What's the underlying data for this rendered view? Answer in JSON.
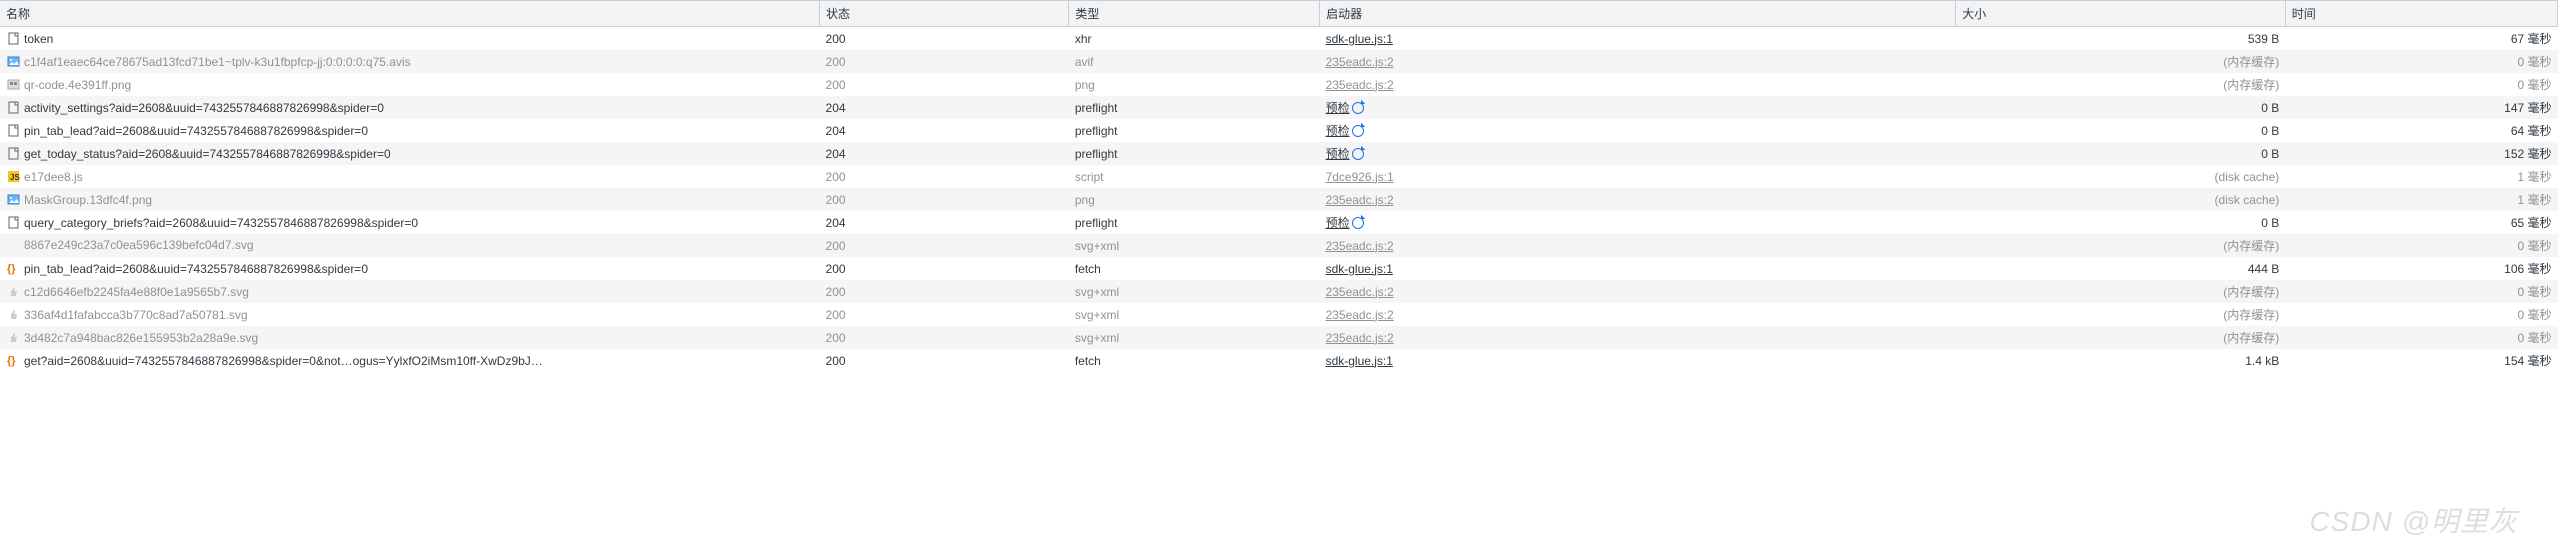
{
  "headers": {
    "name": "名称",
    "status": "状态",
    "type": "类型",
    "initiator": "启动器",
    "size": "大小",
    "time": "时间"
  },
  "labels": {
    "mem_cache": "(内存缓存)",
    "disk_cache": "(disk cache)",
    "precheck": "预检",
    "ms_suffix": "毫秒"
  },
  "rows": [
    {
      "icon": "doc",
      "name": "token",
      "status": "200",
      "type": "xhr",
      "initiator": {
        "text": "sdk-glue.js:1",
        "kind": "link"
      },
      "size": "539 B",
      "time": "67",
      "dim": false
    },
    {
      "icon": "img",
      "name": "c1f4af1eaec64ce78675ad13fcd71be1~tplv-k3u1fbpfcp-jj:0:0:0:0:q75.avis",
      "status": "200",
      "type": "avif",
      "initiator": {
        "text": "235eadc.js:2",
        "kind": "link"
      },
      "size": "mem",
      "time": "0",
      "dim": true
    },
    {
      "icon": "img-gray",
      "name": "qr-code.4e391ff.png",
      "status": "200",
      "type": "png",
      "initiator": {
        "text": "235eadc.js:2",
        "kind": "link"
      },
      "size": "mem",
      "time": "0",
      "dim": true
    },
    {
      "icon": "doc",
      "name": "activity_settings?aid=2608&uuid=7432557846887826998&spider=0",
      "status": "204",
      "type": "preflight",
      "initiator": {
        "text": "precheck",
        "kind": "precheck"
      },
      "size": "0 B",
      "time": "147",
      "dim": false
    },
    {
      "icon": "doc",
      "name": "pin_tab_lead?aid=2608&uuid=7432557846887826998&spider=0",
      "status": "204",
      "type": "preflight",
      "initiator": {
        "text": "precheck",
        "kind": "precheck"
      },
      "size": "0 B",
      "time": "64",
      "dim": false
    },
    {
      "icon": "doc",
      "name": "get_today_status?aid=2608&uuid=7432557846887826998&spider=0",
      "status": "204",
      "type": "preflight",
      "initiator": {
        "text": "precheck",
        "kind": "precheck"
      },
      "size": "0 B",
      "time": "152",
      "dim": false
    },
    {
      "icon": "js",
      "name": "e17dee8.js",
      "status": "200",
      "type": "script",
      "initiator": {
        "text": "7dce926.js:1",
        "kind": "link"
      },
      "size": "disk",
      "time": "1",
      "dim": true
    },
    {
      "icon": "img",
      "name": "MaskGroup.13dfc4f.png",
      "status": "200",
      "type": "png",
      "initiator": {
        "text": "235eadc.js:2",
        "kind": "link"
      },
      "size": "disk",
      "time": "1",
      "dim": true
    },
    {
      "icon": "doc",
      "name": "query_category_briefs?aid=2608&uuid=7432557846887826998&spider=0",
      "status": "204",
      "type": "preflight",
      "initiator": {
        "text": "precheck",
        "kind": "precheck"
      },
      "size": "0 B",
      "time": "65",
      "dim": false
    },
    {
      "icon": "none",
      "name": "8867e249c23a7c0ea596c139befc04d7.svg",
      "status": "200",
      "type": "svg+xml",
      "initiator": {
        "text": "235eadc.js:2",
        "kind": "link"
      },
      "size": "mem",
      "time": "0",
      "dim": true
    },
    {
      "icon": "json",
      "name": "pin_tab_lead?aid=2608&uuid=7432557846887826998&spider=0",
      "status": "200",
      "type": "fetch",
      "initiator": {
        "text": "sdk-glue.js:1",
        "kind": "link"
      },
      "size": "444 B",
      "time": "106",
      "dim": false
    },
    {
      "icon": "thumb",
      "name": "c12d6646efb2245fa4e88f0e1a9565b7.svg",
      "status": "200",
      "type": "svg+xml",
      "initiator": {
        "text": "235eadc.js:2",
        "kind": "link"
      },
      "size": "mem",
      "time": "0",
      "dim": true
    },
    {
      "icon": "thumb",
      "name": "336af4d1fafabcca3b770c8ad7a50781.svg",
      "status": "200",
      "type": "svg+xml",
      "initiator": {
        "text": "235eadc.js:2",
        "kind": "link"
      },
      "size": "mem",
      "time": "0",
      "dim": true
    },
    {
      "icon": "thumb",
      "name": "3d482c7a948bac826e155953b2a28a9e.svg",
      "status": "200",
      "type": "svg+xml",
      "initiator": {
        "text": "235eadc.js:2",
        "kind": "link"
      },
      "size": "mem",
      "time": "0",
      "dim": true
    },
    {
      "icon": "json",
      "name": "get?aid=2608&uuid=7432557846887826998&spider=0&not…ogus=YylxfO2iMsm10ff-XwDz9bJ…",
      "status": "200",
      "type": "fetch",
      "initiator": {
        "text": "sdk-glue.js:1",
        "kind": "link"
      },
      "size": "1.4 kB",
      "time": "154",
      "dim": false
    }
  ],
  "watermark": "CSDN @明里灰"
}
